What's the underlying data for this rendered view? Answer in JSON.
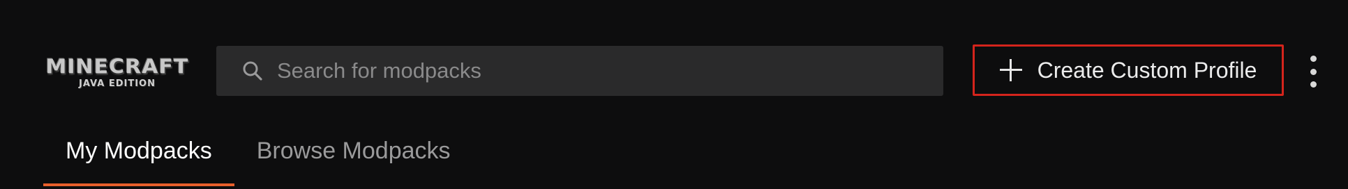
{
  "app": {
    "logo_title": "MINECRAFT",
    "logo_subtitle": "JAVA EDITION"
  },
  "search": {
    "placeholder": "Search for modpacks",
    "value": "",
    "icon": "search-icon"
  },
  "actions": {
    "create_label": "Create Custom Profile",
    "create_icon": "plus-icon",
    "create_border_color": "#d4241c",
    "more_icon": "kebab-menu-icon"
  },
  "tabs": [
    {
      "label": "My Modpacks",
      "active": true
    },
    {
      "label": "Browse Modpacks",
      "active": false
    }
  ],
  "colors": {
    "background": "#0d0d0e",
    "accent": "#e8602c",
    "search_bg": "#2a2a2b"
  }
}
